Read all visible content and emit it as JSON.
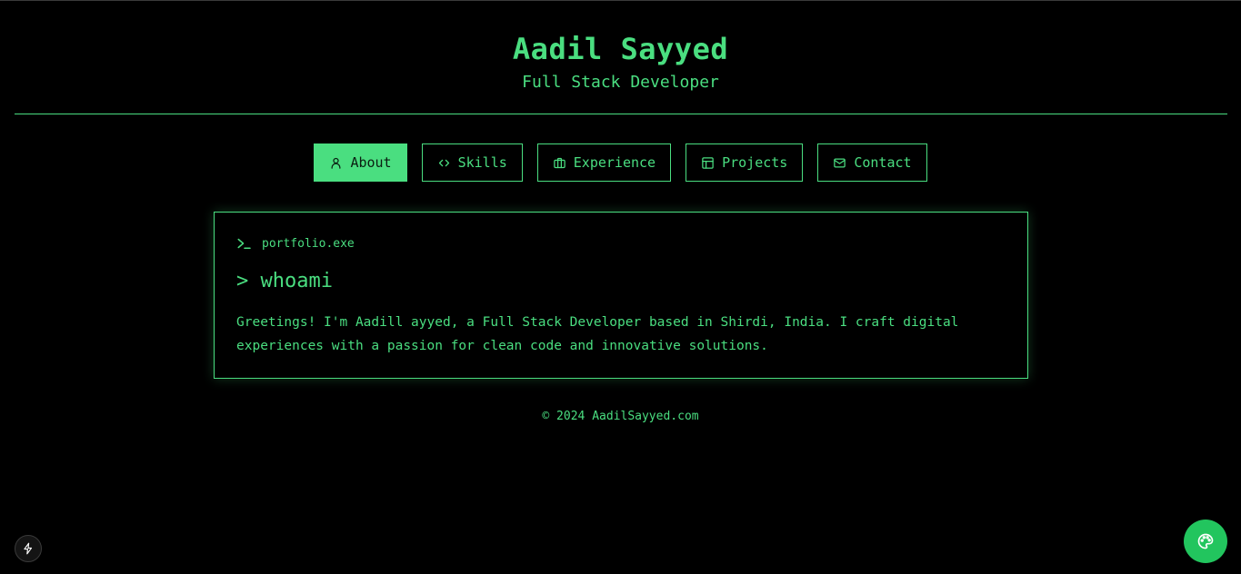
{
  "header": {
    "title": "Aadil Sayyed",
    "subtitle": "Full Stack Developer"
  },
  "nav": {
    "items": [
      {
        "label": "About",
        "icon": "user-icon",
        "active": true
      },
      {
        "label": "Skills",
        "icon": "code-icon",
        "active": false
      },
      {
        "label": "Experience",
        "icon": "briefcase-icon",
        "active": false
      },
      {
        "label": "Projects",
        "icon": "layout-icon",
        "active": false
      },
      {
        "label": "Contact",
        "icon": "mail-icon",
        "active": false
      }
    ]
  },
  "terminal": {
    "filename": "portfolio.exe",
    "command": "> whoami",
    "text": "Greetings! I'm Aadill ayyed, a Full Stack Developer based in Shirdi, India. I craft digital experiences with a passion for clean code and innovative solutions."
  },
  "footer": {
    "copyright": "© 2024 AadilSayyed.com"
  },
  "colors": {
    "accent": "#4ade80",
    "background": "#000000",
    "theme_button": "#22c55e"
  }
}
